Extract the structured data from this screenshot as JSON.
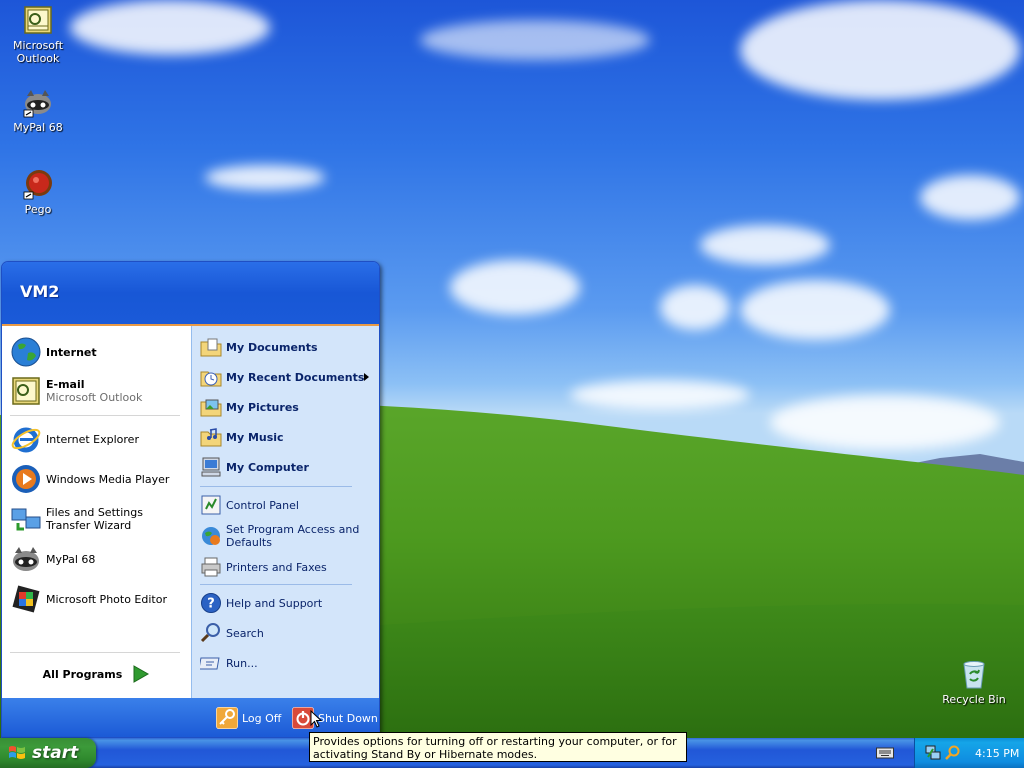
{
  "desktop": {
    "icons": [
      {
        "label": "Microsoft Outlook",
        "icon": "outlook-icon"
      },
      {
        "label": "MyPal 68",
        "icon": "mypal-icon"
      },
      {
        "label": "Pego",
        "icon": "pego-icon"
      },
      {
        "label": "Recycle Bin",
        "icon": "recycle-bin-icon"
      }
    ]
  },
  "start_menu": {
    "user": "VM2",
    "pinned": [
      {
        "label": "Internet",
        "icon": "internet-icon"
      },
      {
        "label": "E-mail",
        "sub": "Microsoft Outlook",
        "icon": "email-icon"
      }
    ],
    "recent": [
      {
        "label": "Internet Explorer",
        "icon": "ie-icon"
      },
      {
        "label": "Windows Media Player",
        "icon": "wmp-icon"
      },
      {
        "label": "Files and Settings Transfer Wizard",
        "icon": "transfer-wizard-icon"
      },
      {
        "label": "MyPal 68",
        "icon": "mypal-icon"
      },
      {
        "label": "Microsoft Photo Editor",
        "icon": "photo-editor-icon"
      }
    ],
    "all_programs": "All Programs",
    "right": {
      "places": [
        {
          "label": "My Documents",
          "icon": "my-documents-icon"
        },
        {
          "label": "My Recent Documents",
          "icon": "recent-documents-icon"
        },
        {
          "label": "My Pictures",
          "icon": "my-pictures-icon"
        },
        {
          "label": "My Music",
          "icon": "my-music-icon"
        },
        {
          "label": "My Computer",
          "icon": "my-computer-icon"
        }
      ],
      "settings": [
        {
          "label": "Control Panel",
          "icon": "control-panel-icon"
        },
        {
          "label": "Set Program Access and Defaults",
          "icon": "program-access-icon"
        },
        {
          "label": "Printers and Faxes",
          "icon": "printers-icon"
        }
      ],
      "help": [
        {
          "label": "Help and Support",
          "icon": "help-icon"
        },
        {
          "label": "Search",
          "icon": "search-icon"
        },
        {
          "label": "Run...",
          "icon": "run-icon"
        }
      ]
    },
    "footer": {
      "log_off": "Log Off",
      "shut_down": "Shut Down"
    }
  },
  "tooltip": "Provides options for turning off or restarting your computer, or for activating Stand By or Hibernate modes.",
  "taskbar": {
    "start_label": "start",
    "clock": "4:15 PM"
  },
  "colors": {
    "taskbar_blue": "#2561de",
    "start_green": "#3c9a3a",
    "tray_blue": "#0f8ce0",
    "menu_right_bg": "#d3e5fa",
    "tooltip_bg": "#ffffe1"
  }
}
